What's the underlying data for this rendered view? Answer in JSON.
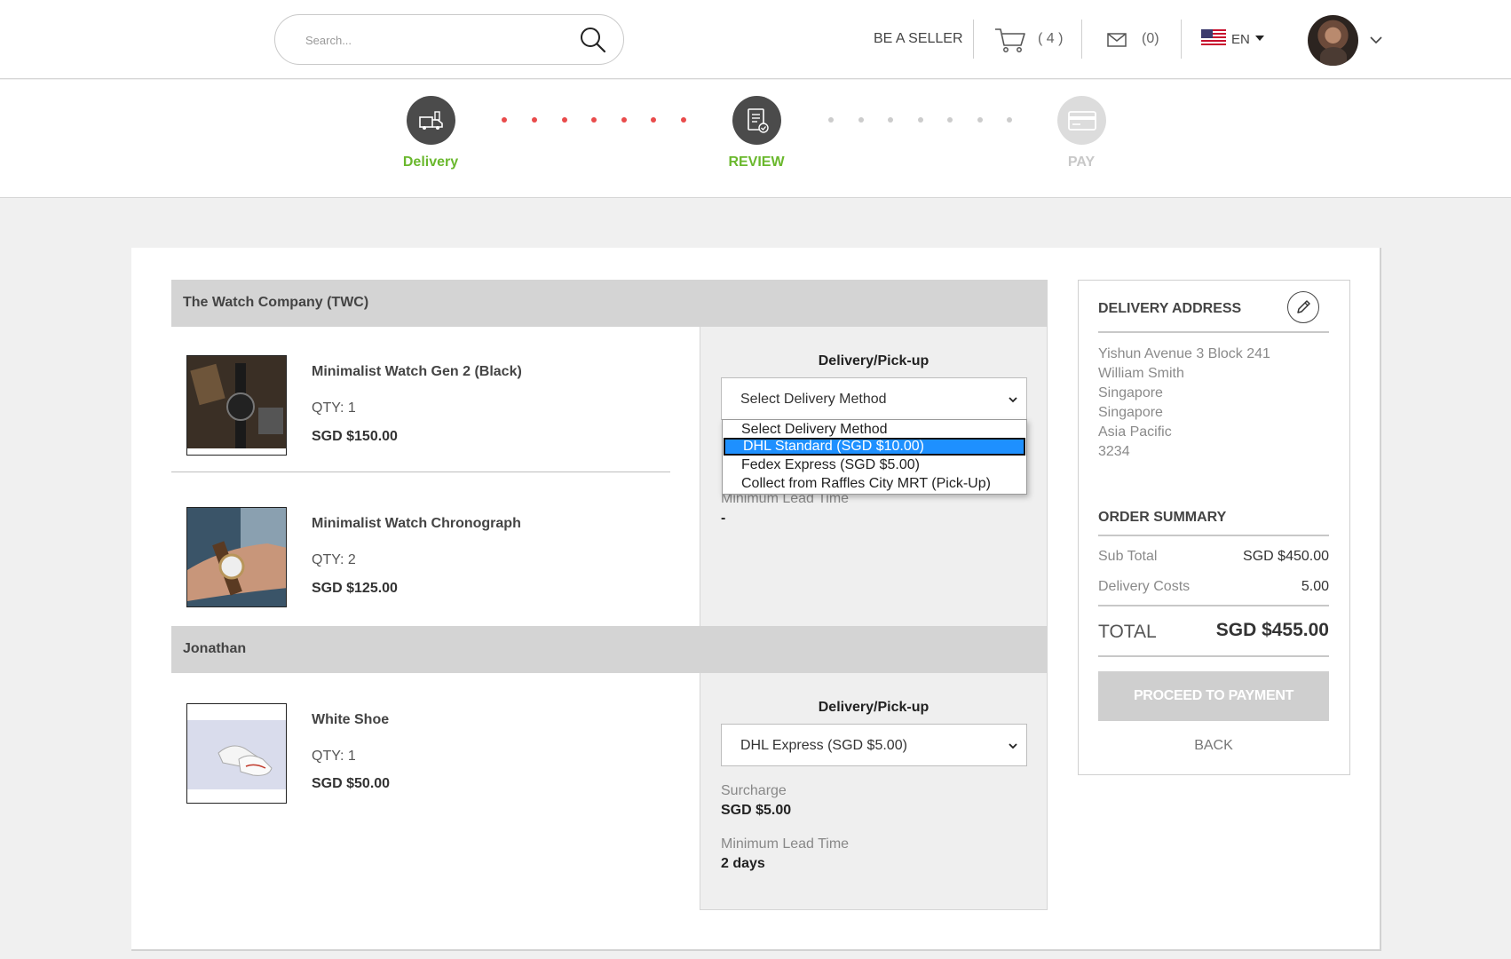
{
  "header": {
    "search_placeholder": "Search...",
    "be_seller": "BE A SELLER",
    "cart_count": "( 4 )",
    "mail_count": "(0)",
    "language": "EN"
  },
  "stepper": {
    "steps": [
      {
        "label": "Delivery",
        "state": "done",
        "color": "#6ab82d"
      },
      {
        "label": "REVIEW",
        "state": "current",
        "color": "#6ab82d"
      },
      {
        "label": "PAY",
        "state": "pending",
        "color": "#c8c8c8"
      }
    ]
  },
  "sellers": [
    {
      "name": "The Watch Company (TWC)",
      "items": [
        {
          "name": "Minimalist Watch Gen 2 (Black)",
          "qty": "QTY: 1",
          "price": "SGD $150.00"
        },
        {
          "name": "Minimalist Watch Chronograph",
          "qty": "QTY: 2",
          "price": "SGD $125.00"
        }
      ],
      "delivery": {
        "title": "Delivery/Pick-up",
        "selected": "Select Delivery Method",
        "lead_time_label": "Minimum Lead Time",
        "lead_time_value": "-",
        "dropdown_options": [
          "Select Delivery Method",
          "DHL Standard (SGD $10.00)",
          "Fedex Express (SGD $5.00)",
          "Collect from Raffles City MRT (Pick-Up)"
        ],
        "highlighted_option": "DHL Standard (SGD $10.00)"
      }
    },
    {
      "name": "Jonathan",
      "items": [
        {
          "name": "White Shoe",
          "qty": "QTY: 1",
          "price": "SGD $50.00"
        }
      ],
      "delivery": {
        "title": "Delivery/Pick-up",
        "selected": "DHL Express (SGD $5.00)",
        "surcharge_label": "Surcharge",
        "surcharge_value": "SGD $5.00",
        "lead_time_label": "Minimum Lead Time",
        "lead_time_value": "2 days"
      }
    }
  ],
  "summary": {
    "address_title": "DELIVERY ADDRESS",
    "address_lines": [
      "Yishun Avenue 3 Block 241",
      "William Smith",
      "Singapore",
      "Singapore",
      "Asia Pacific",
      "3234"
    ],
    "order_title": "ORDER SUMMARY",
    "subtotal_label": "Sub Total",
    "subtotal_value": "SGD $450.00",
    "delivery_label": "Delivery Costs",
    "delivery_value": "5.00",
    "total_label": "TOTAL",
    "total_value": "SGD $455.00",
    "proceed_label": "PROCEED TO PAYMENT",
    "back_label": "BACK"
  },
  "colors": {
    "accent_green": "#6ab82d",
    "progress_red": "#e94b4b",
    "selection_blue": "#1e90ff"
  }
}
